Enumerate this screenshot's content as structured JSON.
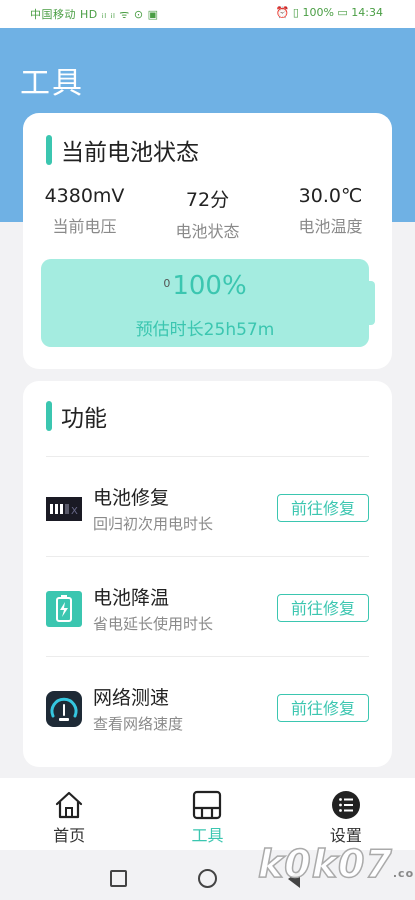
{
  "status_bar": {
    "left_text": "中国移动 HD ᵢₗ ᵢₗ ᯤ ⊙ ▣",
    "right_text": "⏰ ▯ 100% ▭ 14:34"
  },
  "page": {
    "title": "工具"
  },
  "battery_card": {
    "title": "当前电池状态",
    "stats": [
      {
        "value": "4380mV",
        "label": "当前电压"
      },
      {
        "value": "72分",
        "label": "电池状态"
      },
      {
        "value": "30.0℃",
        "label": "电池温度"
      }
    ],
    "level_prefix": "0",
    "level_text": "100%",
    "level_fraction": 1.0,
    "estimate": "预估时长25h57m"
  },
  "function_card": {
    "title": "功能",
    "items": [
      {
        "title": "电池修复",
        "subtitle": "回归初次用电时长",
        "button": "前往修复",
        "icon": "battery-repair-icon"
      },
      {
        "title": "电池降温",
        "subtitle": "省电延长使用时长",
        "button": "前往修复",
        "icon": "battery-cool-icon"
      },
      {
        "title": "网络测速",
        "subtitle": "查看网络速度",
        "button": "前往修复",
        "icon": "speedometer-icon"
      }
    ]
  },
  "bottom_nav": {
    "items": [
      {
        "label": "首页",
        "icon": "home-icon"
      },
      {
        "label": "工具",
        "icon": "tools-icon",
        "active": true
      },
      {
        "label": "设置",
        "icon": "settings-list-icon"
      }
    ]
  },
  "watermark": {
    "text": "k0k07",
    "suffix": ".com"
  },
  "colors": {
    "accent": "#3bc6b0",
    "header": "#6fb1e4",
    "battery_fill": "#a4ece0"
  }
}
